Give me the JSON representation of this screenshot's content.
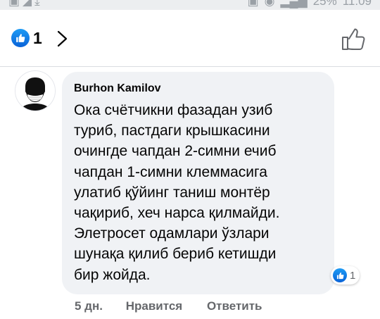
{
  "reactions": {
    "count": "1"
  },
  "comment": {
    "author": "Burhon Kamilov",
    "lines": [
      "Ока счётчикни фазадан узиб",
      "туриб, пастдаги крышкасини",
      "очингде чапдан 2-симни ечиб",
      "чапдан 1-симни клеммасига",
      "улатиб қўйинг таниш монтёр",
      "чақириб, хеч нарса қилмайди.",
      "Элетросет одамлари ўзлари",
      "шунақа қилиб бериб кетишди",
      "бир жойда."
    ],
    "reaction_count": "1",
    "time": "5 дн.",
    "like_label": "Нравится",
    "reply_label": "Ответить"
  },
  "colors": {
    "like_blue": "#1877f2",
    "bubble_bg": "#f0f2f5",
    "meta_gray": "#65676b"
  },
  "icons": [
    "like-badge-icon",
    "chevron-right-icon",
    "thumb-up-outline-icon",
    "avatar-mask-icon"
  ]
}
